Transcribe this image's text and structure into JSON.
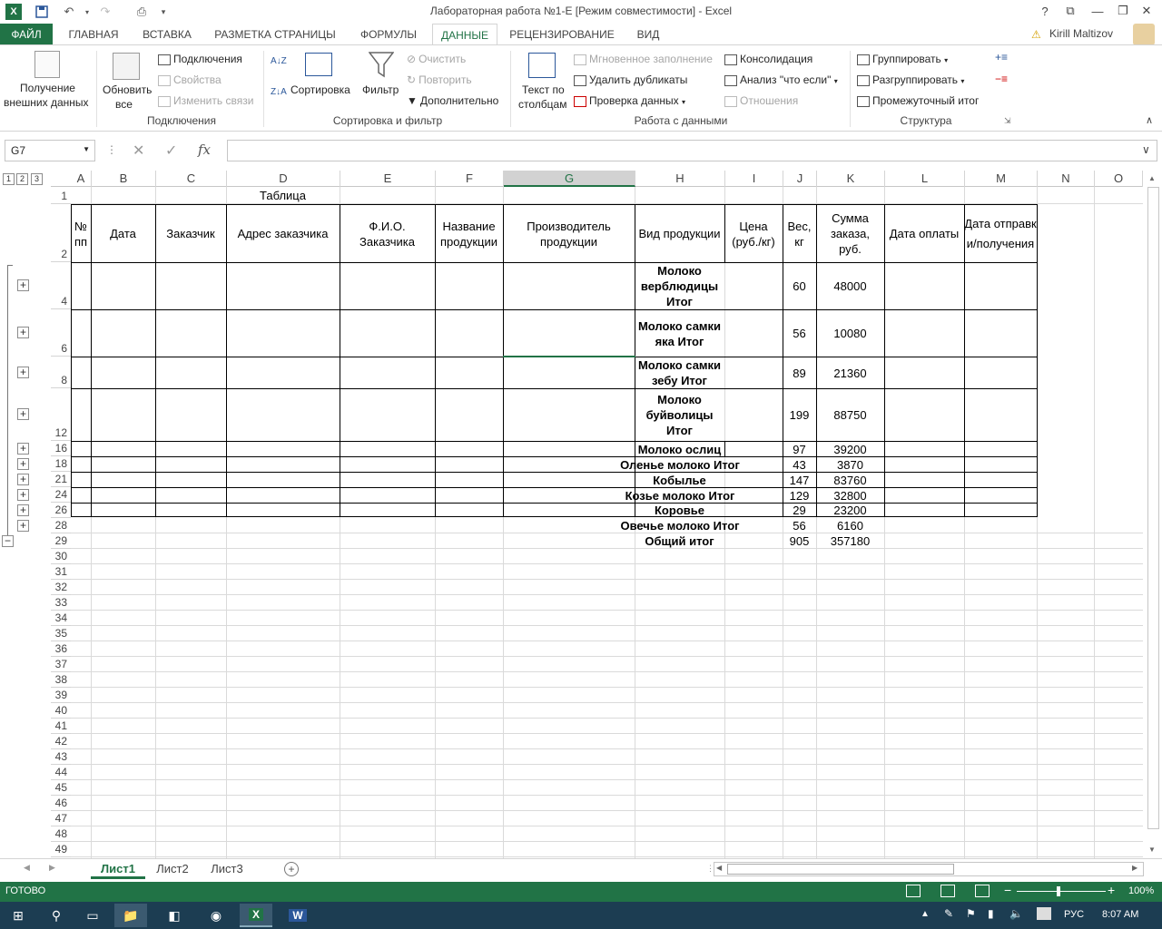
{
  "window": {
    "title": "Лабораторная работа №1-E  [Режим совместимости] - Excel",
    "help": "?",
    "user": "Kirill Maltizov"
  },
  "tabs": [
    {
      "label": "ФАЙЛ"
    },
    {
      "label": "ГЛАВНАЯ"
    },
    {
      "label": "ВСТАВКА"
    },
    {
      "label": "РАЗМЕТКА СТРАНИЦЫ"
    },
    {
      "label": "ФОРМУЛЫ"
    },
    {
      "label": "ДАННЫЕ"
    },
    {
      "label": "РЕЦЕНЗИРОВАНИЕ"
    },
    {
      "label": "ВИД"
    }
  ],
  "ribbon": {
    "get_external": [
      "Получение",
      "внешних данных"
    ],
    "refresh_all": [
      "Обновить",
      "все"
    ],
    "connections": "Подключения",
    "properties": "Свойства",
    "edit_links": "Изменить связи",
    "group_connections": "Подключения",
    "sort": "Сортировка",
    "filter": "Фильтр",
    "clear": "Очистить",
    "reapply": "Повторить",
    "advanced": "Дополнительно",
    "group_sort": "Сортировка и фильтр",
    "text_to_columns": [
      "Текст по",
      "столбцам"
    ],
    "flash_fill": "Мгновенное заполнение",
    "remove_dup": "Удалить дубликаты",
    "validation": "Проверка данных",
    "consolidate": "Консолидация",
    "whatif": "Анализ \"что если\"",
    "relations": "Отношения",
    "group_data": "Работа с данными",
    "group": "Группировать",
    "ungroup": "Разгруппировать",
    "subtotal": "Промежуточный итог",
    "group_structure": "Структура"
  },
  "formula_bar": {
    "name_box": "G7",
    "fx": "fx",
    "value": ""
  },
  "outline_levels": [
    "1",
    "2",
    "3"
  ],
  "columns": [
    "A",
    "B",
    "C",
    "D",
    "E",
    "F",
    "G",
    "H",
    "I",
    "J",
    "K",
    "L",
    "M",
    "N",
    "O"
  ],
  "selected_column": "G",
  "title_cell": "Таблица",
  "headers": {
    "a": "№ пп",
    "b": "Дата",
    "c": "Заказчик",
    "d": "Адрес заказчика",
    "e": "Ф.И.О. Заказчика",
    "f": "Название продукции",
    "g": "Производитель продукции",
    "h": "Вид продукции",
    "i": "Цена (руб./кг)",
    "j": "Вес, кг",
    "k": "Сумма заказа, руб.",
    "l": "Дата оплаты",
    "m": "Дата отправки/получения"
  },
  "rows": [
    {
      "row": "4",
      "product": "Молоко верблюдицы Итог",
      "weight": "60",
      "sum": "48000"
    },
    {
      "row": "6",
      "product": "Молоко самки яка Итог",
      "weight": "56",
      "sum": "10080"
    },
    {
      "row": "8",
      "product": "Молоко самки зебу Итог",
      "weight": "89",
      "sum": "21360"
    },
    {
      "row": "12",
      "product": "Молоко буйволицы Итог",
      "weight": "199",
      "sum": "88750"
    },
    {
      "row": "16",
      "product": "Молоко ослиц",
      "weight": "97",
      "sum": "39200"
    },
    {
      "row": "18",
      "product": "Оленье молоко Итог",
      "weight": "43",
      "sum": "3870"
    },
    {
      "row": "21",
      "product": "Кобылье",
      "weight": "147",
      "sum": "83760"
    },
    {
      "row": "24",
      "product": "Козье молоко Итог",
      "weight": "129",
      "sum": "32800"
    },
    {
      "row": "26",
      "product": "Коровье",
      "weight": "29",
      "sum": "23200"
    },
    {
      "row": "28",
      "product": "Овечье молоко Итог",
      "weight": "56",
      "sum": "6160"
    },
    {
      "row": "29",
      "product": "Общий итог",
      "weight": "905",
      "sum": "357180"
    }
  ],
  "empty_rows": [
    "30",
    "31",
    "32",
    "33",
    "34",
    "35",
    "36",
    "37",
    "38",
    "39",
    "40",
    "41",
    "42",
    "43",
    "44",
    "45",
    "46",
    "47",
    "48",
    "49"
  ],
  "sheets": [
    "Лист1",
    "Лист2",
    "Лист3"
  ],
  "status": {
    "ready": "ГОТОВО",
    "zoom": "100%"
  },
  "taskbar": {
    "lang": "РУС",
    "time": "8:07 AM"
  }
}
